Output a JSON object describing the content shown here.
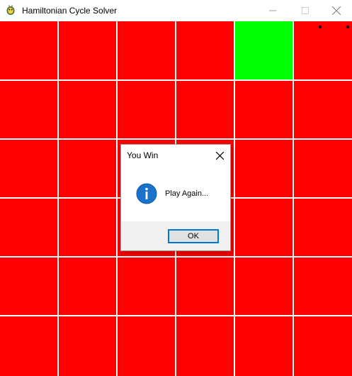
{
  "window": {
    "title": "Hamiltonian Cycle Solver",
    "icon": "pygame-snake-icon",
    "controls": [
      "minimize-icon",
      "maximize-icon",
      "close-icon"
    ]
  },
  "board": {
    "rows": 6,
    "cols": 6,
    "cell_color": "#ff0000",
    "highlight_color": "#00ff00",
    "grid_line_color": "#ffffff",
    "highlighted_cell": {
      "row": 0,
      "col": 4
    },
    "markers": [
      {
        "row": 0,
        "col": 5,
        "position": "top-left"
      },
      {
        "row": 0,
        "col": 5,
        "position": "top-right"
      }
    ]
  },
  "dialog": {
    "title": "You Win",
    "message": "Play Again...",
    "ok_label": "OK",
    "icon": "info-icon",
    "accent_color": "#0078d7"
  }
}
